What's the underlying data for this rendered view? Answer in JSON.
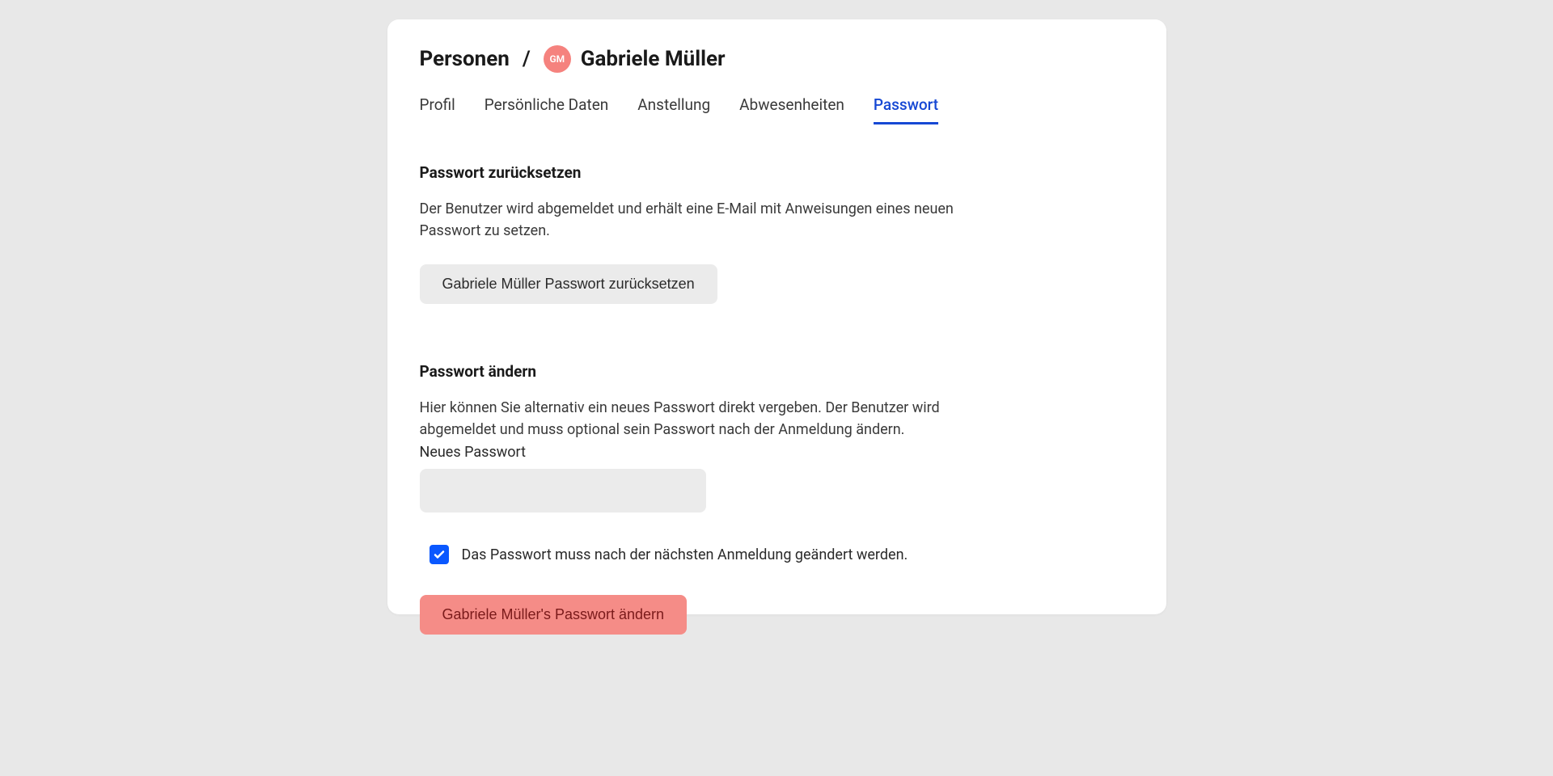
{
  "breadcrumb": {
    "root": "Personen",
    "separator": "/",
    "avatar_initials": "GM",
    "name": "Gabriele Müller"
  },
  "tabs": [
    {
      "label": "Profil",
      "active": false
    },
    {
      "label": "Persönliche Daten",
      "active": false
    },
    {
      "label": "Anstellung",
      "active": false
    },
    {
      "label": "Abwesenheiten",
      "active": false
    },
    {
      "label": "Passwort",
      "active": true
    }
  ],
  "reset_section": {
    "title": "Passwort zurücksetzen",
    "description": "Der Benutzer wird abgemeldet und erhält eine E-Mail mit Anweisungen eines neuen Passwort zu setzen.",
    "button_label": "Gabriele Müller Passwort zurücksetzen"
  },
  "change_section": {
    "title": "Passwort ändern",
    "description": "Hier können Sie alternativ ein neues Passwort direkt vergeben. Der Benutzer wird abgemeldet und muss optional sein Passwort nach der Anmeldung ändern.",
    "input_label": "Neues Passwort",
    "input_value": "",
    "checkbox_checked": true,
    "checkbox_label": "Das Passwort muss nach der nächsten Anmeldung geändert werden.",
    "button_label": "Gabriele Müller's Passwort ändern"
  }
}
